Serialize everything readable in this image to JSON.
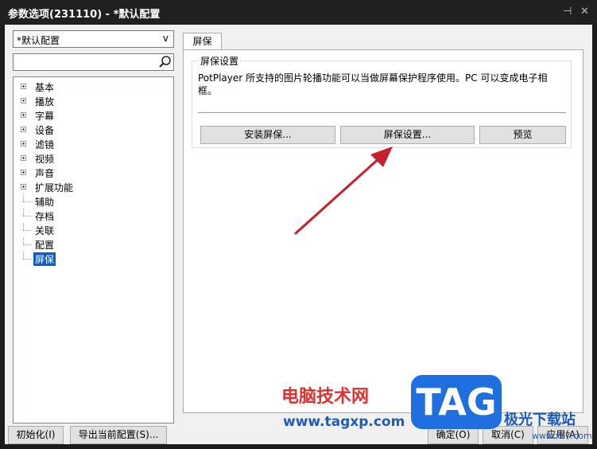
{
  "window": {
    "title": "参数选项(231110) - *默认配置",
    "pin_glyph": "⊣",
    "close_glyph": "✕"
  },
  "sidebar": {
    "preset": "*默认配置",
    "preset_arrow": "v",
    "search_placeholder": "",
    "items": [
      {
        "label": "基本",
        "expandable": true
      },
      {
        "label": "播放",
        "expandable": true
      },
      {
        "label": "字幕",
        "expandable": true
      },
      {
        "label": "设备",
        "expandable": true
      },
      {
        "label": "滤镜",
        "expandable": true
      },
      {
        "label": "视频",
        "expandable": true
      },
      {
        "label": "声音",
        "expandable": true
      },
      {
        "label": "扩展功能",
        "expandable": true
      },
      {
        "label": "辅助",
        "expandable": false
      },
      {
        "label": "存档",
        "expandable": false
      },
      {
        "label": "关联",
        "expandable": false
      },
      {
        "label": "配置",
        "expandable": false
      },
      {
        "label": "屏保",
        "expandable": false,
        "selected": true
      }
    ]
  },
  "main": {
    "tab": "屏保",
    "group_title": "屏保设置",
    "description": "PotPlayer 所支持的图片轮播功能可以当做屏幕保护程序使用。PC 可以变成电子相框。",
    "buttons": {
      "install": "安装屏保...",
      "settings": "屏保设置...",
      "preview": "预览"
    }
  },
  "footer": {
    "reset": "初始化(I)",
    "export": "导出当前配置(S)...",
    "ok": "确定(O)",
    "cancel": "取消(C)",
    "apply": "应用(A)"
  },
  "watermark": {
    "cn": "电脑技术网",
    "url": "www.tagxp.com",
    "tag": "TAG",
    "site": "极光下载站",
    "url2": "www.xz7.com"
  },
  "colors": {
    "selection": "#0a5fc4",
    "arrow": "#c8202a"
  }
}
